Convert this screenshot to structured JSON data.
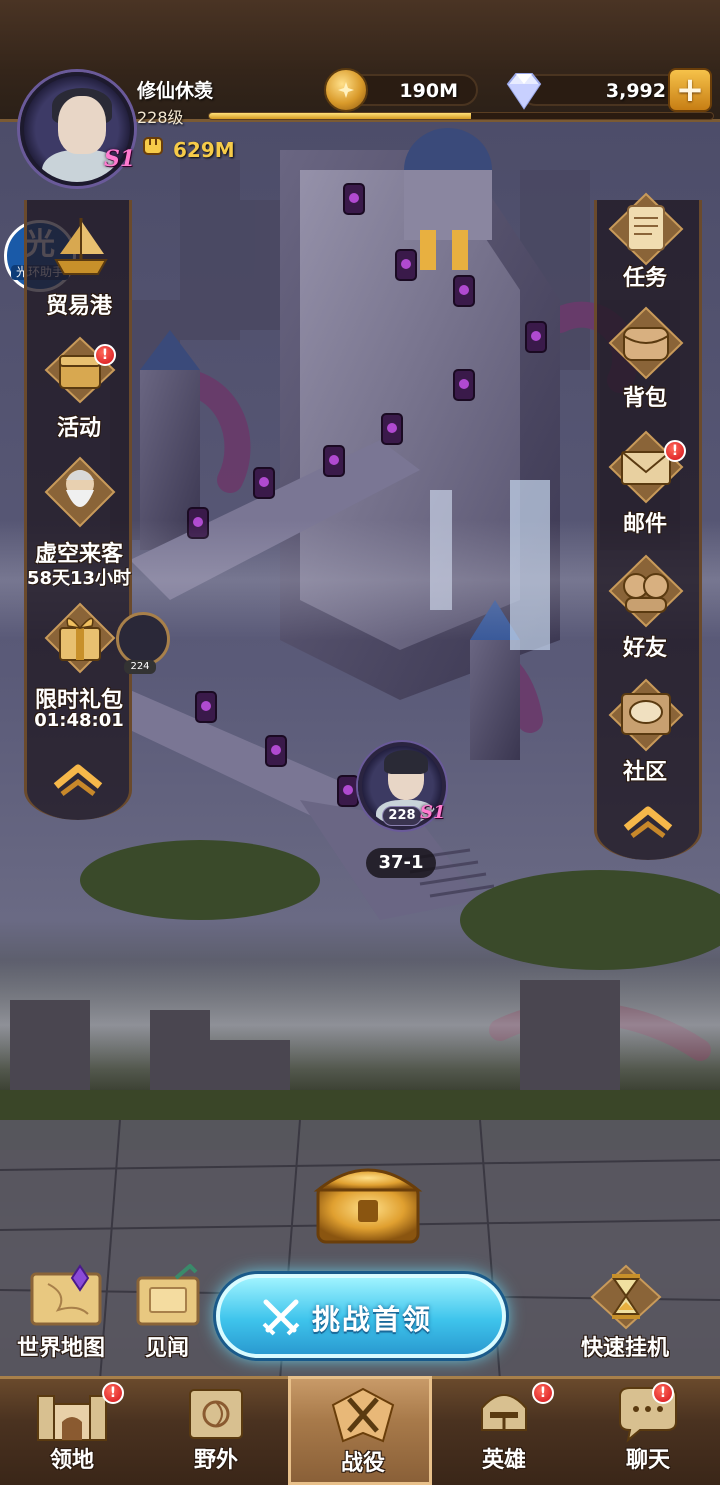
{
  "player": {
    "name": "修仙休羡",
    "level": "228级",
    "server_badge": "S1",
    "power": "629M",
    "xp_fraction": 0.52
  },
  "resources": {
    "gold": "190M",
    "diamonds": "3,992",
    "add_symbol": "+"
  },
  "helper": {
    "glyph": "光",
    "label": "光环助手"
  },
  "left_rail": {
    "items": [
      {
        "label": "贸易港",
        "icon": "ship-icon"
      },
      {
        "label": "活动",
        "icon": "treasure-chest-icon",
        "alert": "!"
      },
      {
        "label": "虚空来客",
        "sub": "58天13小时",
        "icon": "elder-portrait-icon"
      },
      {
        "label": "限时礼包",
        "sub": "01:48:01",
        "icon": "gift-box-icon"
      }
    ]
  },
  "right_rail": {
    "items": [
      {
        "label": "任务",
        "icon": "scroll-icon"
      },
      {
        "label": "背包",
        "icon": "bag-icon"
      },
      {
        "label": "邮件",
        "icon": "envelope-icon",
        "alert": "!"
      },
      {
        "label": "好友",
        "icon": "friends-icon"
      },
      {
        "label": "社区",
        "icon": "chat-bubble-icon"
      }
    ]
  },
  "map": {
    "stage": "37-1",
    "avatar_level": "228",
    "avatar_badge": "S1",
    "portal_level": "224"
  },
  "bottom_actions": {
    "world_map": "世界地图",
    "journal": "见闻",
    "challenge": "挑战首领",
    "quick_afk": "快速挂机"
  },
  "nav": {
    "items": [
      {
        "label": "领地",
        "icon": "castle-icon",
        "alert": "!"
      },
      {
        "label": "野外",
        "icon": "map-scroll-icon"
      },
      {
        "label": "战役",
        "icon": "crossed-swords-icon",
        "active": true
      },
      {
        "label": "英雄",
        "icon": "helmet-icon",
        "alert": "!"
      },
      {
        "label": "聊天",
        "icon": "speech-bubble-icon",
        "alert": "!"
      }
    ]
  },
  "colors": {
    "accent_gold": "#f6cb49",
    "challenge_blue": "#3ec4ec",
    "alert_red": "#d4101a",
    "badge_pink": "#ff7ad0"
  }
}
